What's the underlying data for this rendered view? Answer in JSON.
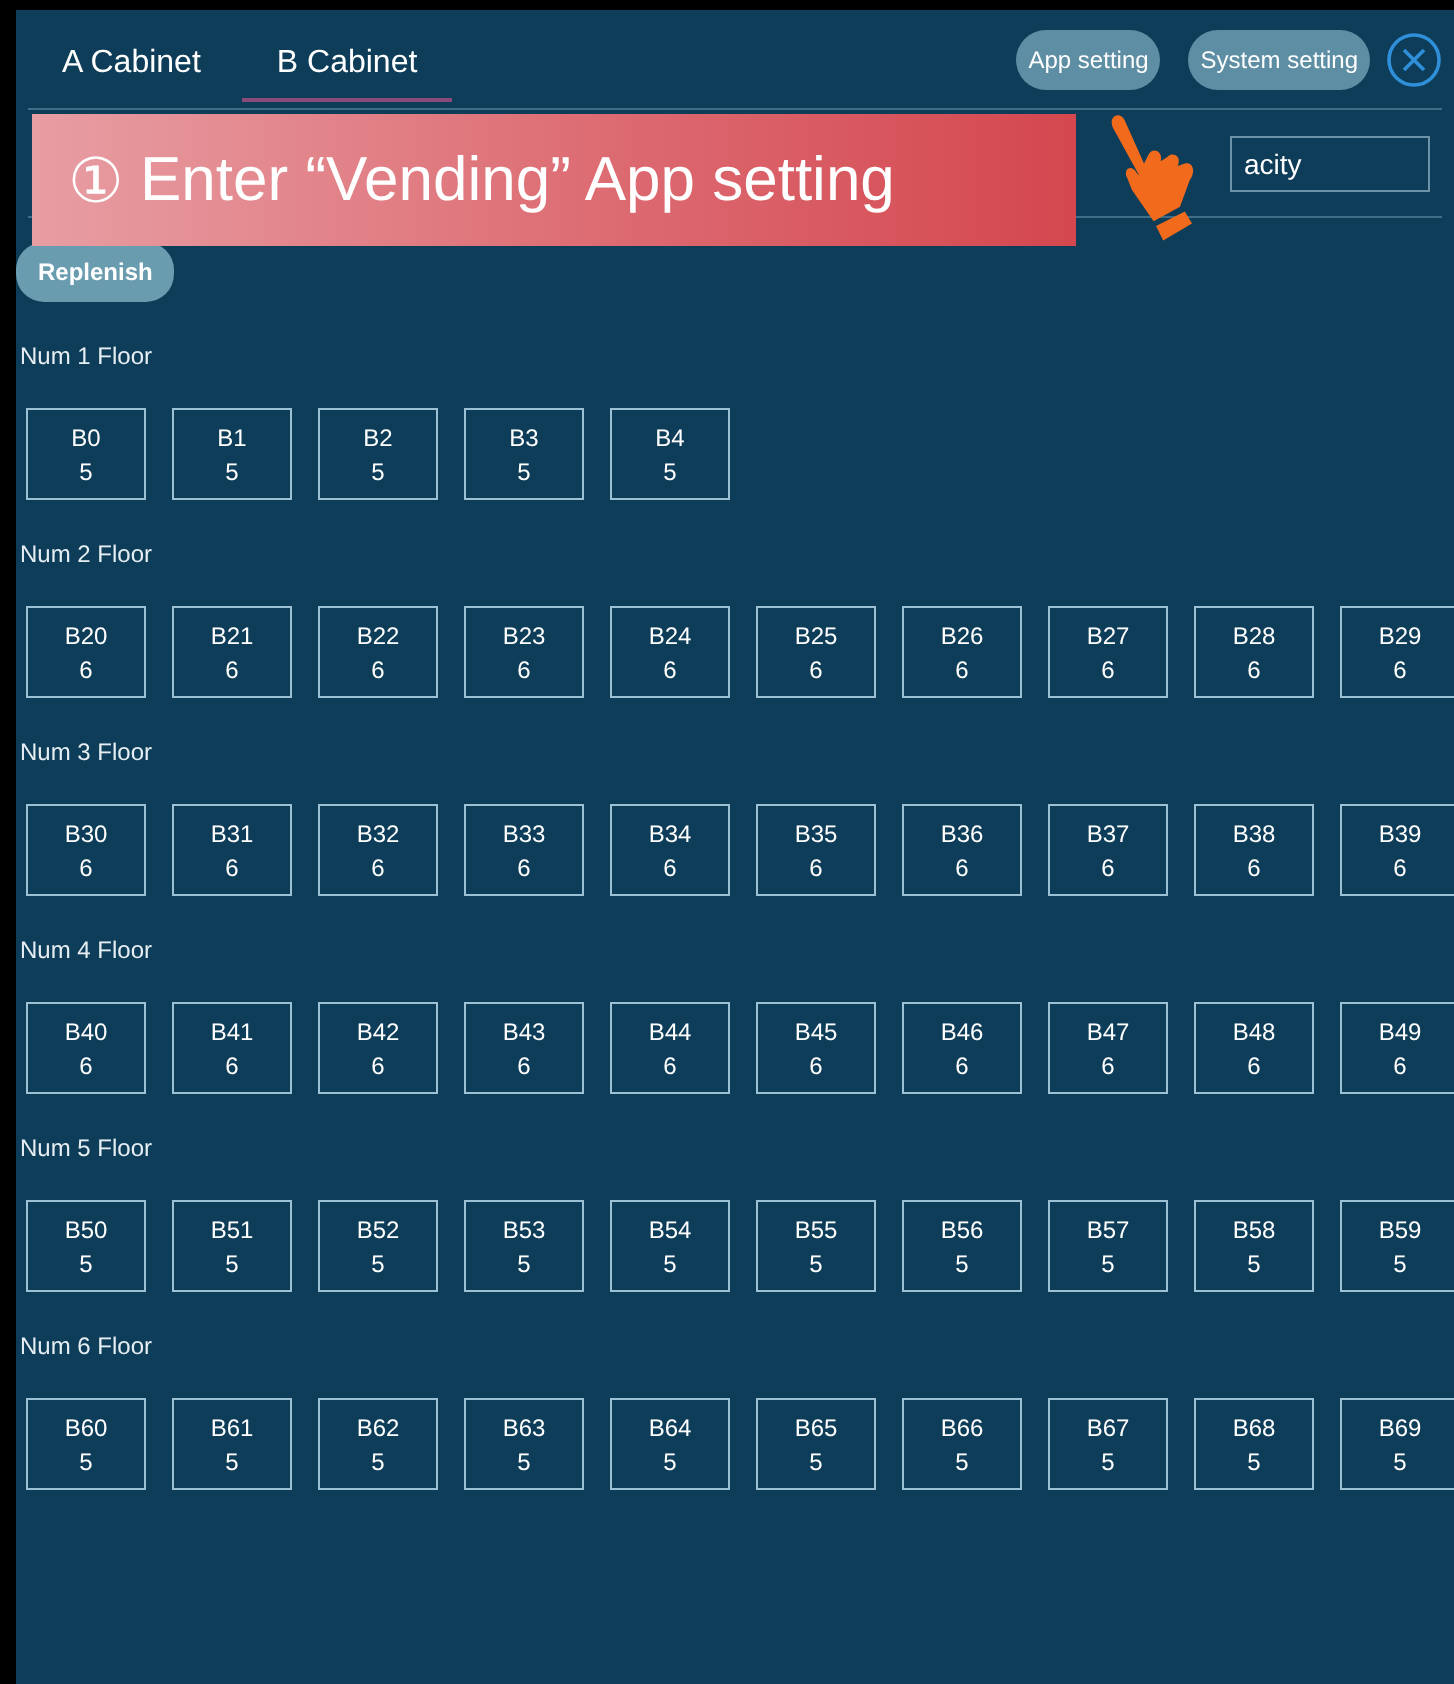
{
  "tabs": [
    {
      "label": "A Cabinet",
      "selected": false
    },
    {
      "label": "B Cabinet",
      "selected": true
    }
  ],
  "header_buttons": [
    "App setting",
    "System setting"
  ],
  "capacity_field": {
    "value": "acity"
  },
  "replenish_button": "Replenish",
  "floors": [
    {
      "label": "Num 1 Floor",
      "slots": [
        {
          "code": "B0",
          "count": "5"
        },
        {
          "code": "B1",
          "count": "5"
        },
        {
          "code": "B2",
          "count": "5"
        },
        {
          "code": "B3",
          "count": "5"
        },
        {
          "code": "B4",
          "count": "5"
        }
      ]
    },
    {
      "label": "Num 2 Floor",
      "slots": [
        {
          "code": "B20",
          "count": "6"
        },
        {
          "code": "B21",
          "count": "6"
        },
        {
          "code": "B22",
          "count": "6"
        },
        {
          "code": "B23",
          "count": "6"
        },
        {
          "code": "B24",
          "count": "6"
        },
        {
          "code": "B25",
          "count": "6"
        },
        {
          "code": "B26",
          "count": "6"
        },
        {
          "code": "B27",
          "count": "6"
        },
        {
          "code": "B28",
          "count": "6"
        },
        {
          "code": "B29",
          "count": "6"
        }
      ]
    },
    {
      "label": "Num 3 Floor",
      "slots": [
        {
          "code": "B30",
          "count": "6"
        },
        {
          "code": "B31",
          "count": "6"
        },
        {
          "code": "B32",
          "count": "6"
        },
        {
          "code": "B33",
          "count": "6"
        },
        {
          "code": "B34",
          "count": "6"
        },
        {
          "code": "B35",
          "count": "6"
        },
        {
          "code": "B36",
          "count": "6"
        },
        {
          "code": "B37",
          "count": "6"
        },
        {
          "code": "B38",
          "count": "6"
        },
        {
          "code": "B39",
          "count": "6"
        }
      ]
    },
    {
      "label": "Num 4 Floor",
      "slots": [
        {
          "code": "B40",
          "count": "6"
        },
        {
          "code": "B41",
          "count": "6"
        },
        {
          "code": "B42",
          "count": "6"
        },
        {
          "code": "B43",
          "count": "6"
        },
        {
          "code": "B44",
          "count": "6"
        },
        {
          "code": "B45",
          "count": "6"
        },
        {
          "code": "B46",
          "count": "6"
        },
        {
          "code": "B47",
          "count": "6"
        },
        {
          "code": "B48",
          "count": "6"
        },
        {
          "code": "B49",
          "count": "6"
        }
      ]
    },
    {
      "label": "Num 5 Floor",
      "slots": [
        {
          "code": "B50",
          "count": "5"
        },
        {
          "code": "B51",
          "count": "5"
        },
        {
          "code": "B52",
          "count": "5"
        },
        {
          "code": "B53",
          "count": "5"
        },
        {
          "code": "B54",
          "count": "5"
        },
        {
          "code": "B55",
          "count": "5"
        },
        {
          "code": "B56",
          "count": "5"
        },
        {
          "code": "B57",
          "count": "5"
        },
        {
          "code": "B58",
          "count": "5"
        },
        {
          "code": "B59",
          "count": "5"
        }
      ]
    },
    {
      "label": "Num 6 Floor",
      "slots": [
        {
          "code": "B60",
          "count": "5"
        },
        {
          "code": "B61",
          "count": "5"
        },
        {
          "code": "B62",
          "count": "5"
        },
        {
          "code": "B63",
          "count": "5"
        },
        {
          "code": "B64",
          "count": "5"
        },
        {
          "code": "B65",
          "count": "5"
        },
        {
          "code": "B66",
          "count": "5"
        },
        {
          "code": "B67",
          "count": "5"
        },
        {
          "code": "B68",
          "count": "5"
        },
        {
          "code": "B69",
          "count": "5"
        }
      ]
    }
  ],
  "overlay": {
    "step": "①",
    "text": "Enter “Vending” App setting"
  }
}
